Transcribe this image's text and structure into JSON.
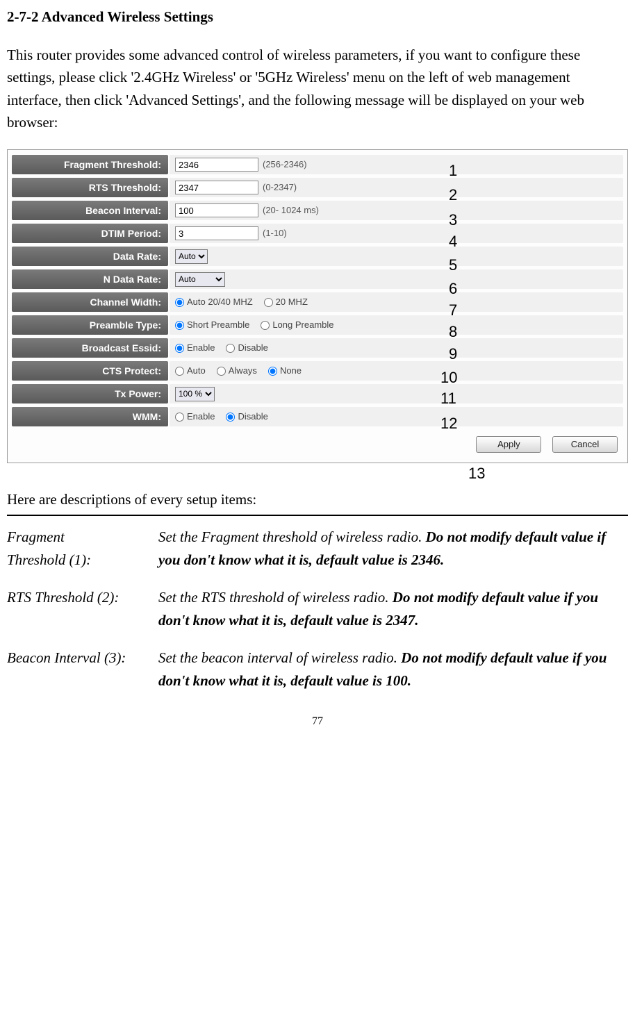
{
  "heading": "2-7-2 Advanced Wireless Settings",
  "intro": "This router provides some advanced control of wireless parameters, if you want to configure these settings, please click '2.4GHz Wireless' or '5GHz Wireless' menu on the left of web management interface, then click 'Advanced Settings', and the following message will be displayed on your web browser:",
  "form": {
    "fragment": {
      "label": "Fragment Threshold:",
      "value": "2346",
      "hint": "(256-2346)"
    },
    "rts": {
      "label": "RTS Threshold:",
      "value": "2347",
      "hint": "(0-2347)"
    },
    "beacon": {
      "label": "Beacon Interval:",
      "value": "100",
      "hint": "(20- 1024 ms)"
    },
    "dtim": {
      "label": "DTIM Period:",
      "value": "3",
      "hint": "(1-10)"
    },
    "dataRate": {
      "label": "Data Rate:",
      "value": "Auto"
    },
    "nDataRate": {
      "label": "N Data Rate:",
      "value": "Auto"
    },
    "chWidth": {
      "label": "Channel Width:",
      "opt1": "Auto 20/40 MHZ",
      "opt2": "20 MHZ"
    },
    "preamble": {
      "label": "Preamble Type:",
      "opt1": "Short Preamble",
      "opt2": "Long Preamble"
    },
    "bssid": {
      "label": "Broadcast Essid:",
      "opt1": "Enable",
      "opt2": "Disable"
    },
    "cts": {
      "label": "CTS Protect:",
      "opt1": "Auto",
      "opt2": "Always",
      "opt3": "None"
    },
    "tx": {
      "label": "Tx Power:",
      "value": "100 %"
    },
    "wmm": {
      "label": "WMM:",
      "opt1": "Enable",
      "opt2": "Disable"
    },
    "apply": "Apply",
    "cancel": "Cancel"
  },
  "annots": [
    "1",
    "2",
    "3",
    "4",
    "5",
    "6",
    "7",
    "8",
    "9",
    "10",
    "11",
    "12",
    "13"
  ],
  "descIntro": "Here are descriptions of every setup items:",
  "rows": [
    {
      "c1a": "Fragment",
      "c1b": "Threshold (1):",
      "c2_normal": "Set the Fragment threshold of wireless radio.    ",
      "c2_bold1": "Do not modify default value if you don't know what it is, default value is 2346.",
      "c2_normal2": ""
    },
    {
      "c1a": "RTS Threshold (2):",
      "c1b": "",
      "c2_normal": "Set the RTS threshold of wireless radio. ",
      "c2_bold1": "Do not modify default value if you don't know what it is, default value is 2347.",
      "c2_normal2": ""
    },
    {
      "c1a": "Beacon Interval (3):",
      "c1b": "",
      "c2_normal": "Set the beacon interval of wireless radio. ",
      "c2_bold1": "Do not modify default value if you don't know what it is, default value is 100.",
      "c2_normal2": ""
    }
  ],
  "pageNum": "77"
}
